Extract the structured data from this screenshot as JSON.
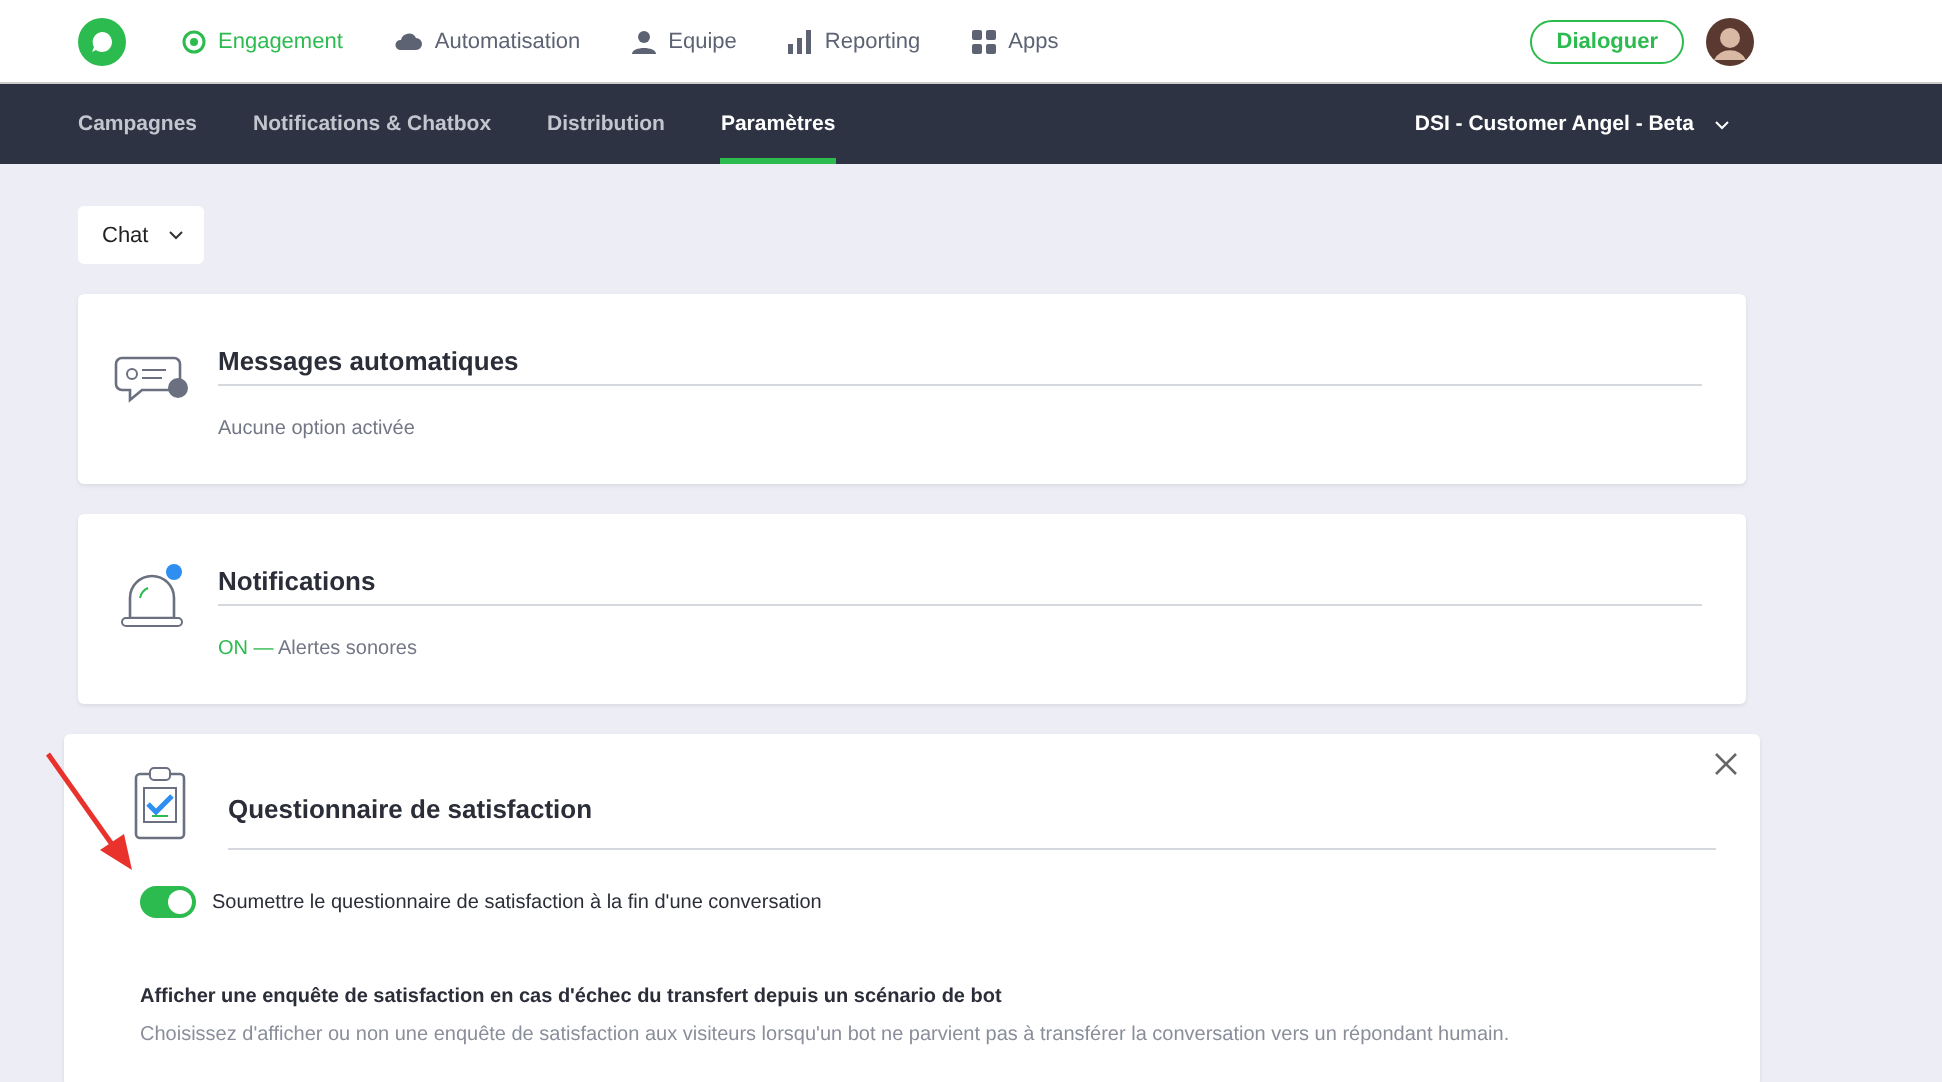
{
  "top_nav": {
    "items": [
      {
        "label": "Engagement",
        "selected": true
      },
      {
        "label": "Automatisation",
        "selected": false
      },
      {
        "label": "Equipe",
        "selected": false
      },
      {
        "label": "Reporting",
        "selected": false
      },
      {
        "label": "Apps",
        "selected": false
      }
    ],
    "action_button": "Dialoguer"
  },
  "sub_nav": {
    "tabs": [
      {
        "label": "Campagnes",
        "selected": false
      },
      {
        "label": "Notifications & Chatbox",
        "selected": false
      },
      {
        "label": "Distribution",
        "selected": false
      },
      {
        "label": "Paramètres",
        "selected": true
      }
    ],
    "account": "DSI - Customer Angel - Beta"
  },
  "channel_select": "Chat",
  "sections": [
    {
      "title": "Messages automatiques",
      "summary": "Aucune option activée",
      "expanded": false
    },
    {
      "title": "Notifications",
      "status": "ON —",
      "summary": "Alertes sonores",
      "expanded": false
    },
    {
      "title": "Questionnaire de satisfaction",
      "expanded": true,
      "toggle": {
        "label": "Soumettre le questionnaire de satisfaction à la fin d'une conversation",
        "on": true
      },
      "option_title": "Afficher une enquête de satisfaction en cas d'échec du transfert depuis un scénario de bot",
      "option_description": "Choisissez d'afficher ou non une enquête de satisfaction aux visiteurs lorsqu'un bot ne parvient pas à transférer la conversation vers un répondant humain."
    }
  ]
}
